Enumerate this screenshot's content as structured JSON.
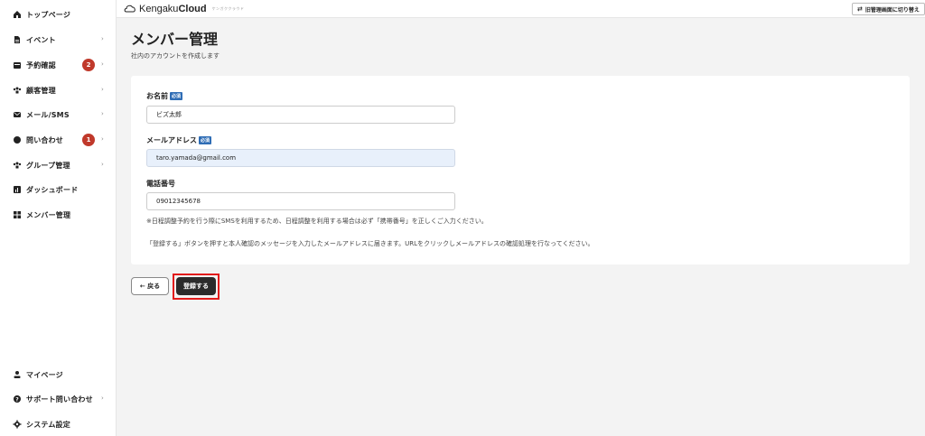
{
  "sidebar": {
    "items": [
      {
        "label": "トップページ",
        "icon": "home-icon"
      },
      {
        "label": "イベント",
        "icon": "document-icon"
      },
      {
        "label": "予約確認",
        "icon": "calendar-icon",
        "badge": "2"
      },
      {
        "label": "顧客管理",
        "icon": "users-icon"
      },
      {
        "label": "メール/SMS",
        "icon": "mail-icon"
      },
      {
        "label": "問い合わせ",
        "icon": "chat-icon",
        "badge": "1"
      },
      {
        "label": "グループ管理",
        "icon": "group-icon"
      },
      {
        "label": "ダッシュボード",
        "icon": "dashboard-icon"
      },
      {
        "label": "メンバー管理",
        "icon": "grid-icon"
      }
    ],
    "bottom_items": [
      {
        "label": "マイページ",
        "icon": "person-icon"
      },
      {
        "label": "サポート問い合わせ",
        "icon": "help-icon"
      },
      {
        "label": "システム設定",
        "icon": "gear-icon"
      }
    ]
  },
  "header": {
    "logo_light": "Kengaku",
    "logo_bold": "Cloud",
    "logo_sub": "ケンガククラウド",
    "switch_label": "旧管理画面に切り替え"
  },
  "main": {
    "title": "メンバー管理",
    "subtitle": "社内のアカウントを作成します",
    "form": {
      "name_label": "お名前",
      "name_value": "ビズ太郎",
      "email_label": "メールアドレス",
      "email_value": "taro.yamada@gmail.com",
      "phone_label": "電話番号",
      "phone_value": "09012345678",
      "required_tag": "必須",
      "phone_note": "※日程調整予約を行う際にSMSを利用するため、日程調整を利用する場合は必ず「携帯番号」を正しくご入力ください。",
      "confirm_note": "「登録する」ボタンを押すと本人確認のメッセージを入力したメールアドレスに届きます。URLをクリックしメールアドレスの確認処理を行なってください。"
    },
    "back_label": "← 戻る",
    "submit_label": "登録する"
  },
  "colors": {
    "accent": "#2f6db5",
    "badge": "#c0392b",
    "highlight": "#e21b1b",
    "submit": "#2b2b2b"
  }
}
